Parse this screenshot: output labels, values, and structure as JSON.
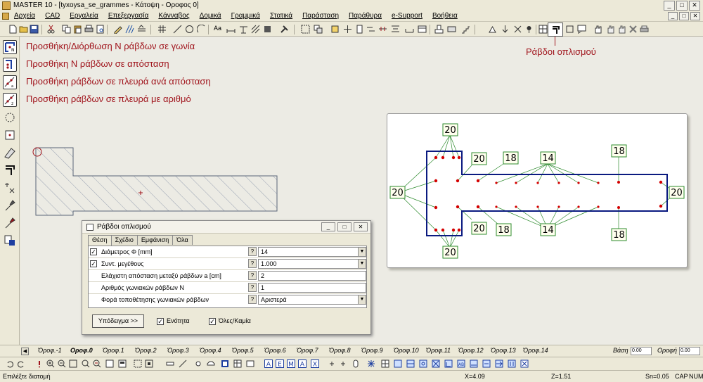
{
  "window": {
    "title": "MASTER 10 - [tyxoysa_se_grammes - Κάτοψη - Οροφος 0]",
    "controls": [
      "_",
      "□",
      "✕"
    ]
  },
  "menu": {
    "items": [
      "Αρχεία",
      "CAD",
      "Εργαλεία",
      "Επεξεργασία",
      "Κάνναβος",
      "Δομικά",
      "Γραμμικά",
      "Στατικά",
      "Παράσταση",
      "Παράθυρα",
      "e-Support",
      "Βοήθεια"
    ],
    "controls": [
      "_",
      "□",
      "✕"
    ]
  },
  "toolbar": {
    "active_tool": "rebars-tool-icon",
    "text_tool_label": "Aa"
  },
  "annotations": {
    "commands": [
      "Προσθήκη/Διόρθωση Ν ράβδων σε γωνία",
      "Προσθήκη Ν ράβδων σε απόσταση",
      "Προσθήκη ράβδων σε πλευρά ανά απόσταση",
      "Προσθήκη ράβδων σε πλευρά με αριθμό"
    ],
    "callout": "Ράβδοι οπλισμού"
  },
  "preview": {
    "labels": {
      "top_left": "20",
      "top_inner": "20",
      "top_mid": "18",
      "top_center": "14",
      "top_right": "18",
      "left": "20",
      "right": "20",
      "bottom_inner": "20",
      "bottom_mid": "18",
      "bottom_center": "14",
      "bottom_right": "18",
      "bottom_left": "20"
    },
    "colors": {
      "outline": "#0a1a80",
      "dot": "#d40000",
      "leader": "#2e8b2e",
      "label_bg": "#ffffee"
    }
  },
  "dialog": {
    "title": "Ράβδοι οπλισμού",
    "tabs": [
      "Θέση",
      "Σχέδιο",
      "Εμφάνιση",
      "Όλα"
    ],
    "rows": [
      {
        "checked": true,
        "label": "Διάμετρος Φ [mm]",
        "value": "14",
        "dropdown": true
      },
      {
        "checked": true,
        "label": "Συντ. μεγέθους",
        "value": "1.000",
        "dropdown": true
      },
      {
        "checked": false,
        "label": "Ελάχιστη απόσταση μεταξύ ράβδων a [cm]",
        "value": "2",
        "dropdown": false
      },
      {
        "checked": false,
        "label": "Αριθμός γωνιακών ράβδων Ν",
        "value": "1",
        "dropdown": false
      },
      {
        "checked": false,
        "label": "Φορά τοποθέτησης γωνιακών ράβδων",
        "value": "Αριστερά",
        "dropdown": true
      }
    ],
    "help_label": "?",
    "example_button": "Υπόδειγμα >>",
    "checkbox_unit": "Ενότητα",
    "checkbox_all": "Όλες/Καμία"
  },
  "floor_tabs": {
    "items": [
      "Όροφ.-1",
      "Οροφ.0",
      "Όροφ.1",
      "Όροφ.2",
      "Όροφ.3",
      "Όροφ.4",
      "Όροφ.5",
      "Όροφ.6",
      "Όροφ.7",
      "Όροφ.8",
      "Όροφ.9",
      "Όροφ.10",
      "Όροφ.11",
      "Όροφ.12",
      "Όροφ.13",
      "Όροφ.14"
    ],
    "active_index": 1,
    "base_label": "Βάση",
    "base_value": "0.00",
    "elevation_label": "Οροφή",
    "elevation_value": "0.00"
  },
  "status": {
    "prompt": "Επιλέξτε διατομή",
    "x": "X=4.09",
    "z": "Z=1.51",
    "sn": "Sn=0.05",
    "caps": "CAP",
    "num": "NUM"
  }
}
